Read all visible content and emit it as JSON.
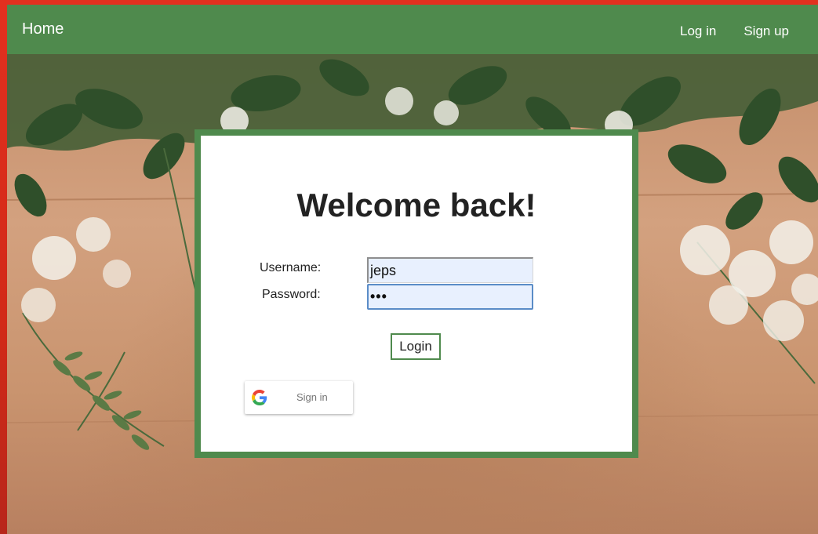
{
  "nav": {
    "home": "Home",
    "login": "Log in",
    "signup": "Sign up"
  },
  "form": {
    "title": "Welcome back!",
    "username_label": "Username:",
    "password_label": "Password:",
    "username_value": "jeps",
    "password_value": "•••",
    "login_button": "Login",
    "google_button": "Sign in"
  },
  "colors": {
    "frame": "#e2301f",
    "navbar": "#4f8a4d",
    "card_border": "#4f8a4d",
    "input_autofill": "#e8f0fe"
  },
  "icons": {
    "google": "google-g-icon"
  }
}
